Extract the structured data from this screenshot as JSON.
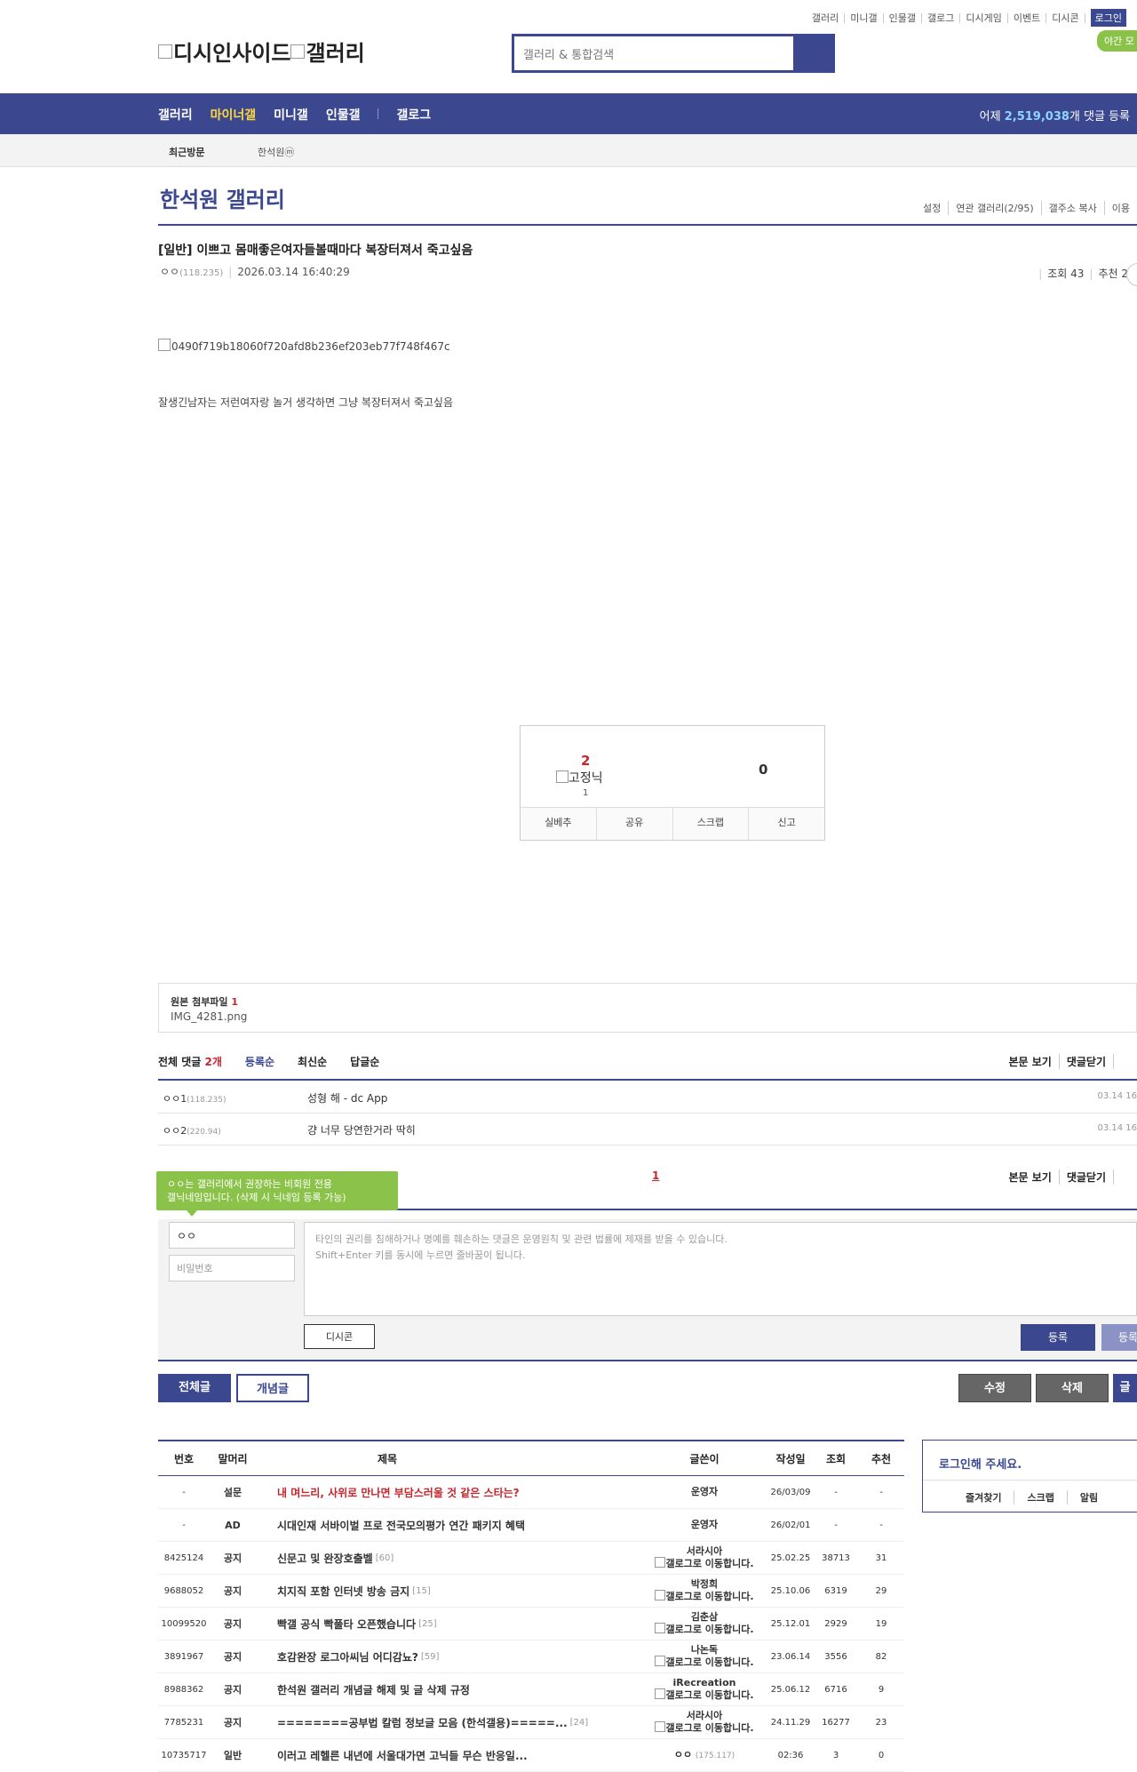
{
  "top_links": [
    "갤러리",
    "미니갤",
    "인물갤",
    "갤로그",
    "디시게임",
    "이벤트",
    "디시콘"
  ],
  "login_label": "로그인",
  "night_label": "야간 모",
  "logo_alt": "디시인사이드",
  "logo_alt2": "갤러리",
  "search_placeholder": "갤러리 & 통합검색",
  "main_menu": [
    "갤러리",
    "마이너갤",
    "미니갤",
    "인물갤",
    "갤로그"
  ],
  "stats": {
    "prefix": "어제 ",
    "count": "2,519,038",
    "suffix": "개 댓글 등록"
  },
  "subnav": {
    "recent": "최근방문",
    "item": "한석원ⓜ"
  },
  "gallery": {
    "title": "한석원 갤러리",
    "links": [
      "설정",
      "연관 갤러리(2/95)",
      "갤주소 복사",
      "이용"
    ]
  },
  "post": {
    "title": "[일반] 이쁘고 몸매좋은여자들볼때마다 복장터져서 죽고싶음",
    "writer": "ㅇㅇ",
    "ip": "(118.235)",
    "date": "2026.03.14 16:40:29",
    "views": "조회 43",
    "recommend": "추천 2",
    "image_alt": "0490f719b18060f720afd8b236ef203eb77f748f467c",
    "body": "잘생긴남자는 저런여자랑 놀거 생각하면 그냥 복장터져서 죽고싶음"
  },
  "vote": {
    "up": "2",
    "fixed": "고정닉",
    "fixed_count": "1",
    "down": "0",
    "buttons": [
      "실베추",
      "공유",
      "스크랩",
      "신고"
    ]
  },
  "attachment": {
    "label": "원본 첨부파일 ",
    "count": "1",
    "file": "IMG_4281.png"
  },
  "comments": {
    "total_label": "전체 댓글 ",
    "total_count": "2개",
    "sort": [
      "등록순",
      "최신순",
      "답글순"
    ],
    "right": [
      "본문 보기",
      "댓글닫기"
    ],
    "items": [
      {
        "writer": "ㅇㅇ1",
        "ip": "(118.235)",
        "text": "성형 해 - dc App",
        "date": "03.14 16"
      },
      {
        "writer": "ㅇㅇ2",
        "ip": "(220.94)",
        "text": "걍 너무 당연한거라 딱히",
        "date": "03.14 16"
      }
    ],
    "page": "1",
    "tooltip1": "ㅇㅇ는 갤러리에서 권장하는 비회원 전용",
    "tooltip2": "갤닉네임입니다. (삭제 시 닉네임 등록 가능)",
    "nick": "ㅇㅇ",
    "pw_placeholder": "비밀번호",
    "ta1": "타인의 권리를 침해하거나 명예를 훼손하는 댓글은 운영원칙 및 관련 법률에 제재를 받을 수 있습니다.",
    "ta2": "Shift+Enter 키를 동시에 누르면 줄바꿈이 됩니다.",
    "dccon": "디시콘",
    "submit": "등록",
    "submit2": "등록"
  },
  "buttons": {
    "all": "전체글",
    "concept": "개념글",
    "edit": "수정",
    "delete": "삭제",
    "write": "글"
  },
  "list": {
    "headers": [
      "번호",
      "말머리",
      "제목",
      "글쓴이",
      "작성일",
      "조회",
      "추천"
    ],
    "rows": [
      {
        "num": "-",
        "head": "설문",
        "title": "내 며느리, 사위로 만나면 부담스러울 것 같은 스타는?",
        "rc": "",
        "writer": "운영자",
        "glog": "",
        "date": "26/03/09",
        "views": "-",
        "rec": "-",
        "red": true
      },
      {
        "num": "-",
        "head": "AD",
        "title": "시대인재 서바이벌 프로 전국모의평가 연간 패키지 혜택",
        "rc": "",
        "writer": "운영자",
        "glog": "",
        "date": "26/02/01",
        "views": "-",
        "rec": "-",
        "red": false
      },
      {
        "num": "8425124",
        "head": "공지",
        "title": "신문고 및 완장호출벨",
        "rc": "[60]",
        "writer": "서라시아",
        "glog": "갤로그로 이동합니다.",
        "date": "25.02.25",
        "views": "38713",
        "rec": "31",
        "red": false
      },
      {
        "num": "9688052",
        "head": "공지",
        "title": "치지직 포함 인터넷 방송 금지",
        "rc": "[15]",
        "writer": "박정희",
        "glog": "갤로그로 이동합니다.",
        "date": "25.10.06",
        "views": "6319",
        "rec": "29",
        "red": false
      },
      {
        "num": "10099520",
        "head": "공지",
        "title": "빡갤 공식 빡풀타 오픈했습니다",
        "rc": "[25]",
        "writer": "김춘삼",
        "glog": "갤로그로 이동합니다.",
        "date": "25.12.01",
        "views": "2929",
        "rec": "19",
        "red": false
      },
      {
        "num": "3891967",
        "head": "공지",
        "title": "호감완장 로그아씨님 어디감뇨?",
        "rc": "[59]",
        "writer": "나논독",
        "glog": "갤로그로 이동합니다.",
        "date": "23.06.14",
        "views": "3556",
        "rec": "82",
        "red": false
      },
      {
        "num": "8988362",
        "head": "공지",
        "title": "한석원 갤러리 개념글 해제 및 글 삭제 규정",
        "rc": "",
        "writer": "iRecreation",
        "glog": "갤로그로 이동합니다.",
        "date": "25.06.12",
        "views": "6716",
        "rec": "9",
        "red": false
      },
      {
        "num": "7785231",
        "head": "공지",
        "title": "========공부법 칼럼 정보글 모음 (한석갤용)=====...",
        "rc": "[24]",
        "writer": "서라시아",
        "glog": "갤로그로 이동합니다.",
        "date": "24.11.29",
        "views": "16277",
        "rec": "23",
        "red": false
      },
      {
        "num": "10735717",
        "head": "일반",
        "title": "이러고 레헬른 내년에 서울대가면 고닉들 무슨 반응일...",
        "rc": "",
        "writer": "ㅇㅇ",
        "ip": "(175.117)",
        "glog": "",
        "date": "02:36",
        "views": "3",
        "rec": "0",
        "red": false
      }
    ]
  },
  "loginbox": {
    "title": "로그인해 주세요.",
    "links": [
      "즐겨찾기",
      "스크랩",
      "알림"
    ]
  }
}
